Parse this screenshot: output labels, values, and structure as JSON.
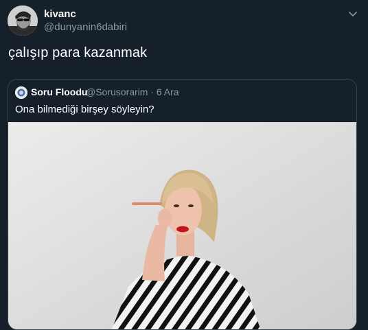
{
  "tweet": {
    "display_name": "kivanc",
    "handle": "@dunyanin6dabiri",
    "text": "çalışıp para kazanmak",
    "menu_icon": "chevron-down-icon"
  },
  "quoted_tweet": {
    "display_name": "Soru Floodu",
    "handle": "@Sorusorarim",
    "separator": "·",
    "date": "6 Ara",
    "text": "Ona bilmediği birşey söyleyin?",
    "media": "photo"
  },
  "colors": {
    "background": "#15202b",
    "border": "#38444d",
    "secondary_text": "#8899a6",
    "primary_text": "#ffffff"
  }
}
